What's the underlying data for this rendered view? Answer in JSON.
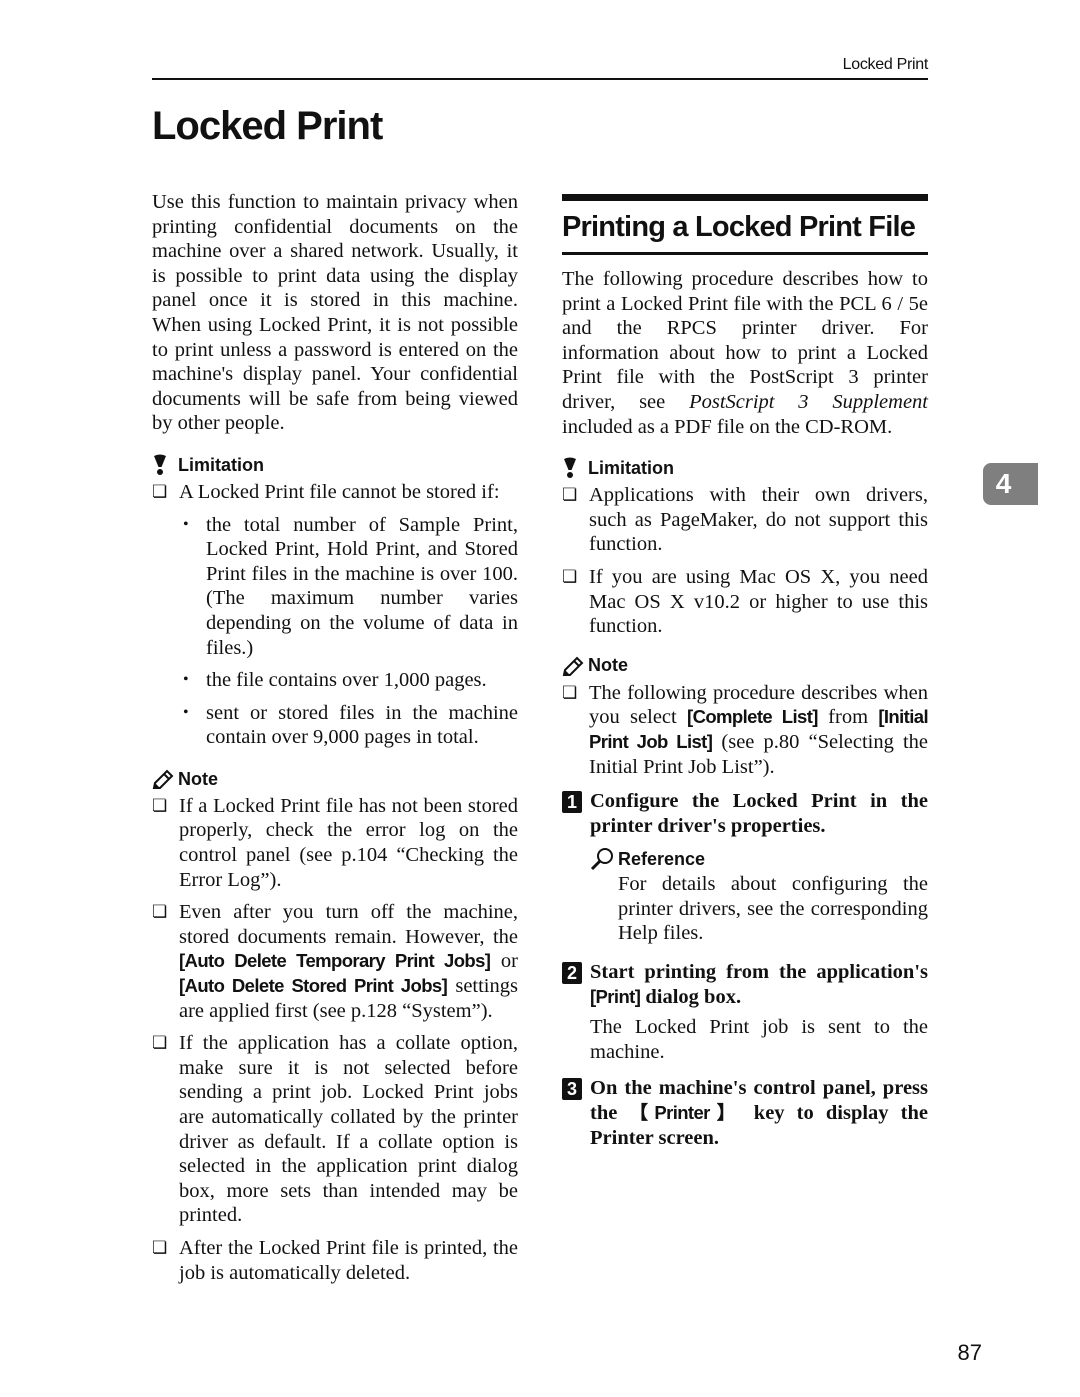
{
  "header": {
    "running_head": "Locked Print",
    "page_title": "Locked Print"
  },
  "left_column": {
    "intro": "Use this function to maintain privacy when printing confidential documents on the machine over a shared network. Usually, it is possible to print data using the display panel once it is stored in this machine. When using Locked Print, it is not possible to print unless a password is entered on the machine's display panel. Your confidential documents will be safe from being viewed by other people.",
    "limitation": {
      "label": "Limitation",
      "icon": "exclamation-icon",
      "item": "A Locked Print file cannot be stored if:",
      "bullets": [
        "the total number of Sample Print, Locked Print, Hold Print, and Stored Print files in the machine is over 100. (The maximum number varies depending on the volume of data in files.)",
        "the file contains over 1,000 pages.",
        "sent or stored files in the machine contain over 9,000 pages in total."
      ]
    },
    "note": {
      "label": "Note",
      "icon": "pencil-icon",
      "items": [
        "If a Locked Print file has not been stored properly, check the error log on the control panel (see p.104 “Checking the Error Log”).",
        {
          "pre": "Even after you turn off the machine, stored documents remain. However, the ",
          "kw1": "[Auto Delete Temporary Print Jobs]",
          "mid": " or ",
          "kw2": "[Auto Delete Stored Print Jobs]",
          "post": " settings are applied first (see p.128 “System”)."
        },
        "If the application has a collate option, make sure it is not selected before sending a print job. Locked Print jobs are automatically collated by the printer driver as default. If a collate option is selected in the application print dialog box, more sets than intended may be printed.",
        "After the Locked Print file is printed, the job is automatically deleted."
      ]
    }
  },
  "right_column": {
    "section_title": "Printing a Locked Print File",
    "intro_pre": "The following procedure describes how to print a Locked Print file with the PCL 6 / 5e and the RPCS printer driver. For information about how to print a Locked Print file with the PostScript 3 printer driver, see ",
    "intro_italic": "PostScript 3 Supplement",
    "intro_post": " included as a PDF file on the CD-ROM.",
    "limitation": {
      "label": "Limitation",
      "icon": "exclamation-icon",
      "items": [
        "Applications with their own drivers, such as PageMaker, do not support this function.",
        "If you are using Mac OS X, you need Mac OS X v10.2 or higher to use this function."
      ]
    },
    "note": {
      "label": "Note",
      "icon": "pencil-icon",
      "item": {
        "pre": "The following procedure describes when you select ",
        "kw1": "[Complete List]",
        "mid": " from ",
        "kw2": "[Initial Print Job List]",
        "post": " (see p.80 “Selecting the Initial Print Job List”)."
      }
    },
    "steps": [
      {
        "number": "1",
        "text": "Configure the Locked Print in the printer driver's properties.",
        "reference": {
          "label": "Reference",
          "icon": "magnifier-icon",
          "text": "For details about configuring the printer drivers, see the corresponding Help files."
        }
      },
      {
        "number": "2",
        "text_pre": "Start printing from the application's ",
        "kw": "[Print]",
        "text_post": " dialog box.",
        "body": "The Locked Print job is sent to the machine."
      },
      {
        "number": "3",
        "text_pre": "On the machine's control panel, press the ",
        "kw": "【Printer】",
        "text_post": " key to display the Printer screen."
      }
    ]
  },
  "chapter_tab": "4",
  "page_number": "87"
}
